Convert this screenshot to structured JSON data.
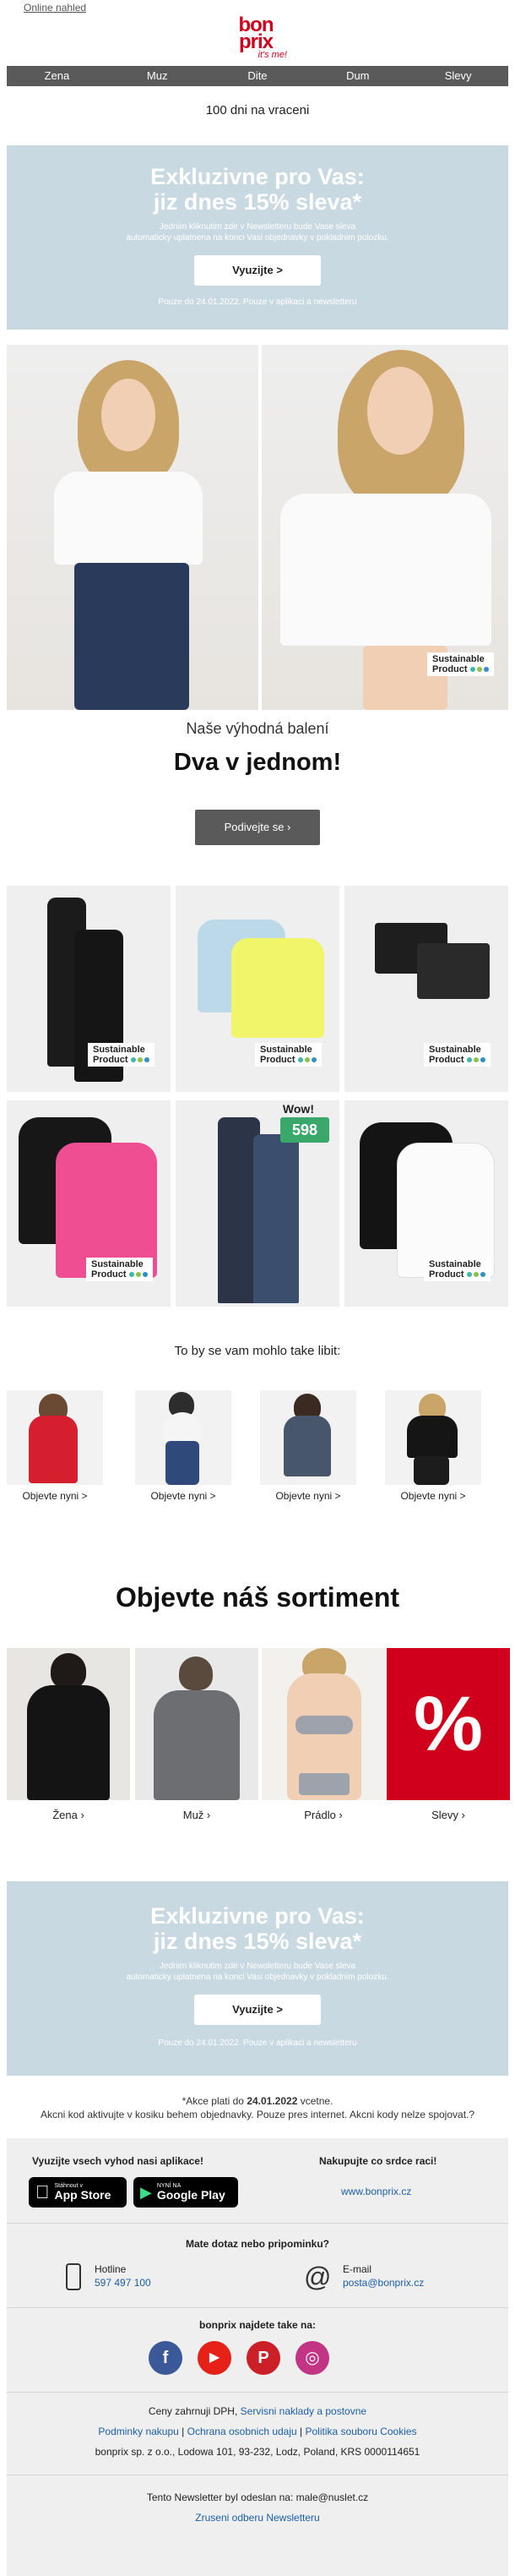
{
  "header": {
    "online_link": "Online nahled",
    "logo": {
      "line1": "bon",
      "line2": "prix",
      "line3": "it's me!"
    },
    "nav": [
      "Zena",
      "Muz",
      "Dite",
      "Dum",
      "Slevy"
    ],
    "tagline": "100 dni na vraceni"
  },
  "promo": {
    "title_line1": "Exkluzivne pro Vas:",
    "title_line2": "jiz dnes 15% sleva*",
    "text_line1": "Jednim kliknutim zde v Newsletteru bude Vase sleva",
    "text_line2": "automaticky uplatnena na konci Vasi objednavky v pokladnim polozku.",
    "button": "Vyuzijte >",
    "note": "Pouze do 24.01.2022. Pouze v aplikaci a newsletteru"
  },
  "badge": {
    "line1": "Sustainable",
    "line2": "Product"
  },
  "colors": {
    "brand": "#d0001d",
    "dot1": "#3fb8a5",
    "dot2": "#8bc34a",
    "dot3": "#2e8fc9",
    "promo_bg": "#c9d9e2",
    "wow_green": "#3aa86b"
  },
  "bundle": {
    "subtitle": "Naše výhodná balení",
    "title": "Dva v jednom!",
    "button": "Podivejte se ›",
    "wow_label": "Wow!",
    "wow_price": "598"
  },
  "recommend": {
    "title": "To by se vam mohlo take libit:",
    "items": [
      "Objevte nyni >",
      "Objevte nyni >",
      "Objevte nyni >",
      "Objevte nyni >"
    ]
  },
  "assortment": {
    "title": "Objevte náš sortiment",
    "categories": [
      "Žena ›",
      "Muž ›",
      "Prádlo ›",
      "Slevy ›"
    ],
    "sale_symbol": "%"
  },
  "footnote": {
    "line1_prefix": "*Akce plati do ",
    "line1_date": "24.01.2022",
    "line1_suffix": " vcetne.",
    "line2": "Akcni kod aktivujte v kosiku behem objednavky. Pouze pres internet. Akcni kody nelze spojovat.?"
  },
  "footer": {
    "app_title": "Vyuzijte vsech vyhod nasi aplikace!",
    "app_store_small": "Stáhnout v",
    "app_store": "App Store",
    "google_small": "NYNÍ NA",
    "google": "Google Play",
    "shop_title": "Nakupujte co srdce raci!",
    "shop_link": "www.bonprix.cz",
    "contact_title": "Mate dotaz nebo pripominku?",
    "hotline_label": "Hotline",
    "hotline_number": "597 497 100",
    "email_label": "E-mail",
    "email_address": "posta@bonprix.cz",
    "social_title": "bonprix najdete take na:",
    "social": [
      "f",
      "▶",
      "P",
      "◎"
    ],
    "vat_text": "Ceny zahrnuji DPH, ",
    "vat_link": "Servisni naklady a postovne",
    "legal_link1": "Podminky nakupu",
    "legal_sep": " | ",
    "legal_link2": "Ochrana osobnich udaju",
    "legal_link3": "Politika souboru Cookies",
    "company": "bonprix sp. z o.o., Lodowa 101, 93-232, Lodz, Poland, KRS 0000114651",
    "sent_to": "Tento Newsletter byl odeslan na: male@nuslet.cz",
    "unsubscribe": "Zruseni odberu Newsletteru"
  }
}
